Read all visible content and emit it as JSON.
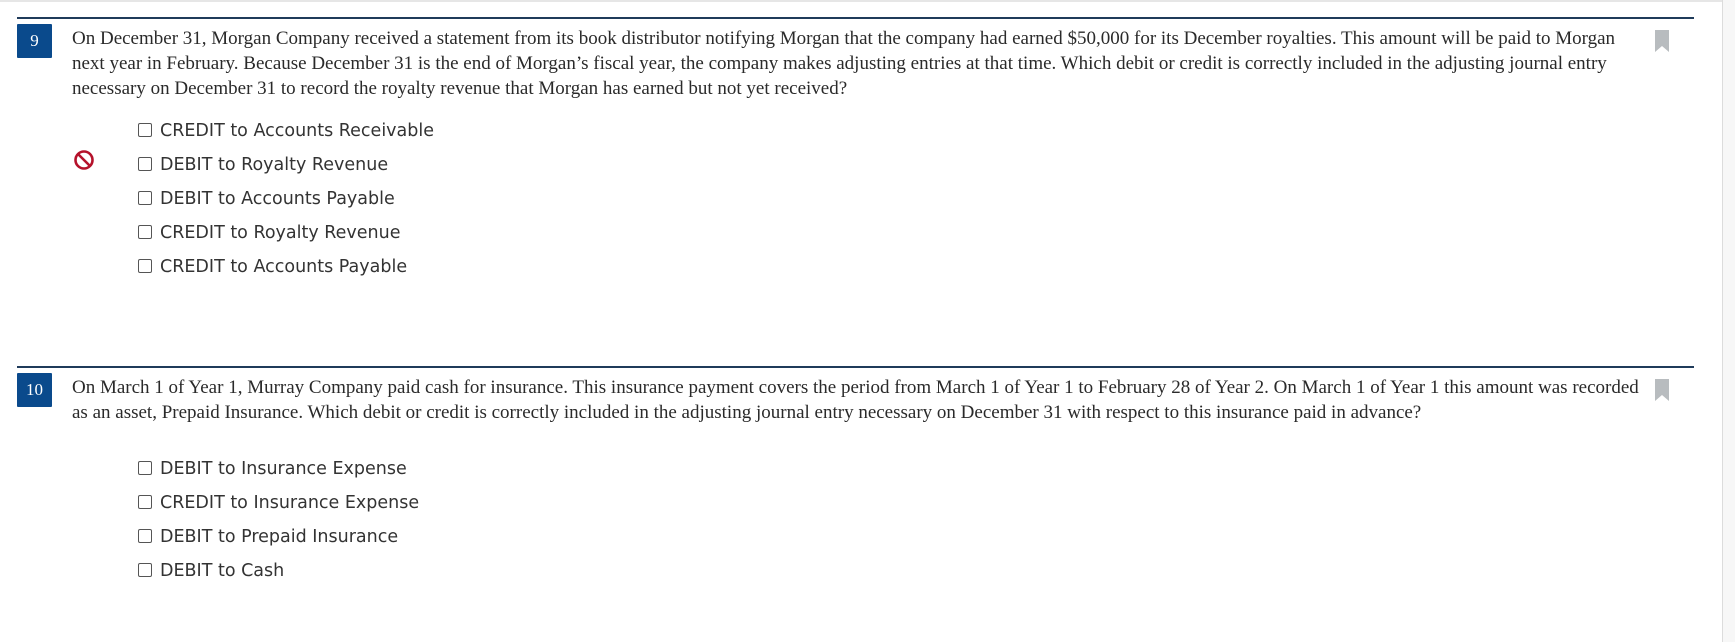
{
  "questions": [
    {
      "number": "9",
      "text": "On December 31, Morgan Company received a statement from its book distributor notifying Morgan that the company had earned $50,000 for its December royalties. This amount will be paid to Morgan next year in February. Because December 31 is the end of Morgan’s fiscal year, the company makes adjusting entries at that time. Which debit or credit is correctly included in the adjusting journal entry necessary on December 31 to record the royalty revenue that Morgan has earned but not yet received?",
      "options": [
        "CREDIT to Accounts Receivable",
        "DEBIT to Royalty Revenue",
        "DEBIT to Accounts Payable",
        "CREDIT to Royalty Revenue",
        "CREDIT to Accounts Payable"
      ],
      "feedback_icon": "prohibited-icon",
      "feedback_color": "#b5122b"
    },
    {
      "number": "10",
      "text": "On March 1 of Year 1, Murray Company paid cash for insurance. This insurance payment covers the period from March 1 of Year 1 to February 28 of Year 2. On March 1 of Year 1 this amount was recorded as an asset, Prepaid Insurance. Which debit or credit is correctly included in the adjusting journal entry necessary on December 31 with respect to this insurance paid in advance?",
      "options": [
        "DEBIT to Insurance Expense",
        "CREDIT to Insurance Expense",
        "DEBIT to Prepaid Insurance",
        "DEBIT to Cash"
      ]
    }
  ],
  "colors": {
    "number_badge": "#0a4a8c",
    "rule": "#1f3b5a",
    "bookmark": "#b8bcbf"
  }
}
